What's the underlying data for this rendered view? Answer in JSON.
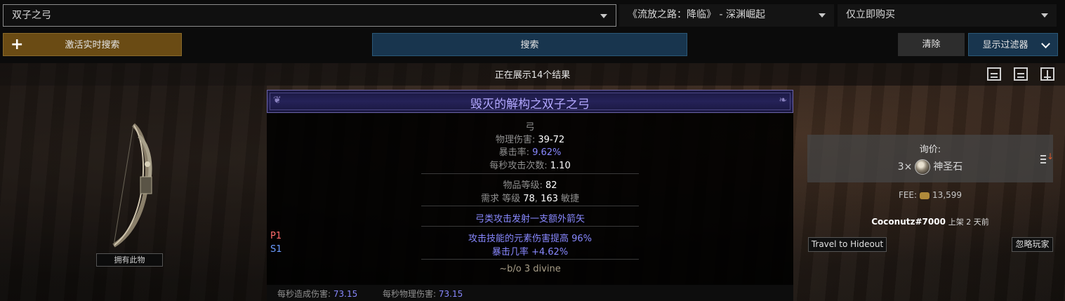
{
  "search": {
    "item_type": "双子之弓",
    "league": "《流放之路：降临》 - 深渊崛起",
    "buyout": "仅立即购买"
  },
  "buttons": {
    "live_search": "激活实时搜索",
    "search": "搜索",
    "clear": "清除",
    "show_filters": "显示过滤器"
  },
  "results": {
    "count_text": "正在展示14个结果"
  },
  "item": {
    "owned_label": "拥有此物",
    "name": "毁灭的解构之双子之弓",
    "class": "弓",
    "phys_label": "物理伤害:",
    "phys_value": "39-72",
    "crit_label": "暴击率:",
    "crit_value": "9.62%",
    "aps_label": "每秒攻击次数:",
    "aps_value": "1.10",
    "ilvl_label": "物品等级:",
    "ilvl_value": "82",
    "req_prefix": "需求 等级",
    "req_level": "78",
    "req_sep": ",",
    "req_dex": "163",
    "req_suffix": "敏捷",
    "implicit": "弓类攻击发射一支额外箭矢",
    "mod1_tag": "P1",
    "mod1": "攻击技能的元素伤害提高 96%",
    "mod2_tag": "S1",
    "mod2": "暴击几率 +4.62%",
    "note": "~b/o 3 divine",
    "dps_label": "每秒造成伤害:",
    "dps_value": "73.15",
    "pdps_label": "每秒物理伤害:",
    "pdps_value": "73.15"
  },
  "listing": {
    "price_title": "询价:",
    "price_amount": "3×",
    "price_currency": "神圣石",
    "fee_label": "FEE:",
    "fee_value": "13,599",
    "seller": "Coconutz#7000",
    "listed": "上架 2 天前",
    "travel": "Travel to Hideout",
    "ignore": "忽略玩家"
  },
  "colors": {
    "live_button": "#6a4b14",
    "search_button": "#18354e",
    "item_name": "#b3a8ff",
    "magic_mod": "#8888ff",
    "prefix_tag": "#ff6b6b",
    "suffix_tag": "#6b9bff"
  }
}
